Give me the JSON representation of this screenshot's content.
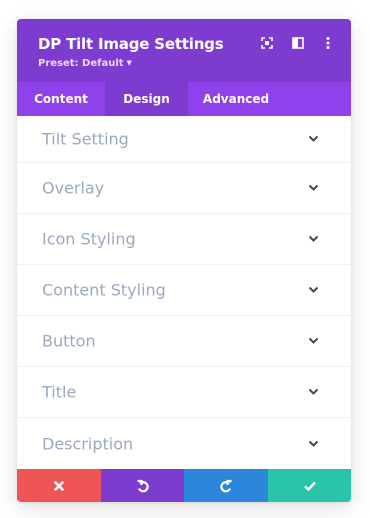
{
  "header": {
    "title": "DP Tilt Image Settings",
    "preset_label": "Preset: Default",
    "background": "#7e3bd0",
    "icons": [
      "expand-icon",
      "sidebar-icon",
      "more-icon"
    ]
  },
  "tabs": [
    {
      "label": "Content",
      "active": false
    },
    {
      "label": "Design",
      "active": true
    },
    {
      "label": "Advanced",
      "active": false
    }
  ],
  "sections": [
    {
      "label": "Tilt Setting"
    },
    {
      "label": "Overlay"
    },
    {
      "label": "Icon Styling"
    },
    {
      "label": "Content Styling"
    },
    {
      "label": "Button"
    },
    {
      "label": "Title"
    },
    {
      "label": "Description"
    }
  ],
  "footer": {
    "buttons": [
      {
        "name": "discard",
        "icon": "close-icon",
        "color": "#ef5555"
      },
      {
        "name": "undo",
        "icon": "undo-icon",
        "color": "#7e3bd0"
      },
      {
        "name": "redo",
        "icon": "redo-icon",
        "color": "#2b87da"
      },
      {
        "name": "save",
        "icon": "check-icon",
        "color": "#29c4a9"
      }
    ]
  }
}
